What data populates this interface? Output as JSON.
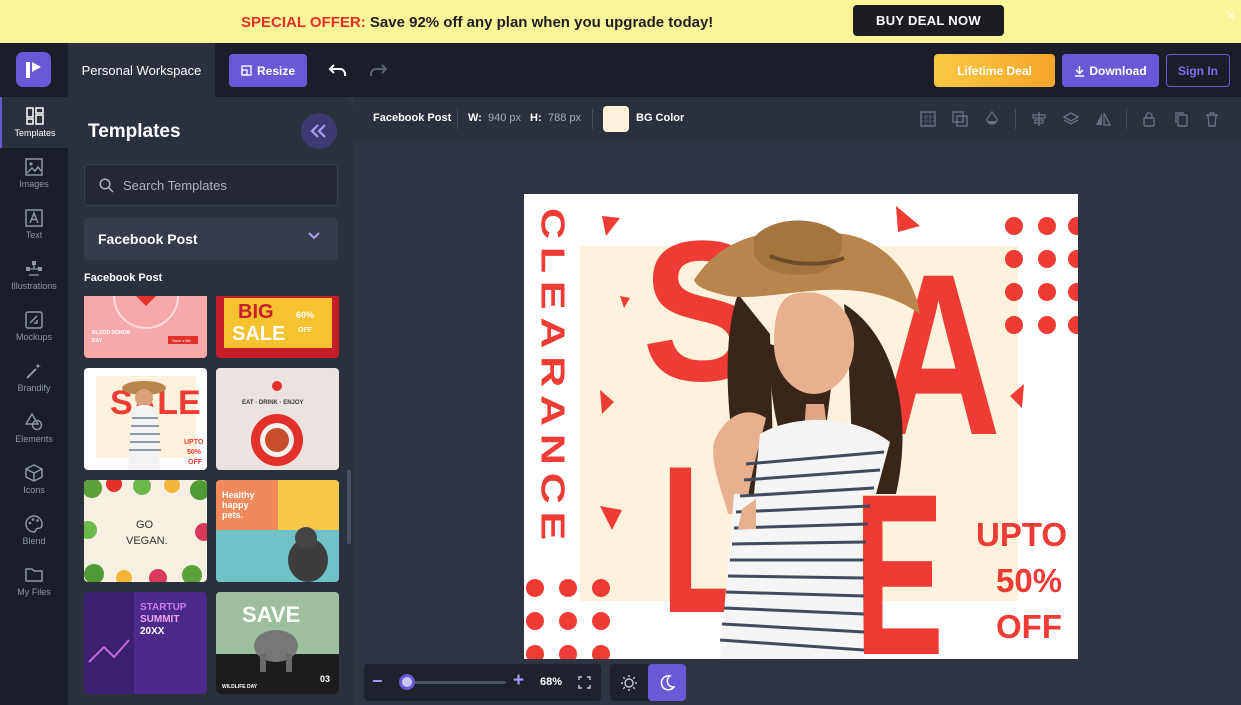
{
  "promo": {
    "highlight": "SPECIAL OFFER:",
    "message": " Save 92% off any plan when you upgrade today!",
    "cta": "BUY DEAL NOW",
    "close": "×"
  },
  "topbar": {
    "workspace": "Personal Workspace",
    "resize": "Resize",
    "lifetime_deal": "Lifetime Deal",
    "download": "Download",
    "sign_in": "Sign In"
  },
  "sidebar": {
    "items": [
      {
        "label": "Templates",
        "icon": "templates-icon"
      },
      {
        "label": "Images",
        "icon": "image-icon"
      },
      {
        "label": "Text",
        "icon": "text-icon"
      },
      {
        "label": "Illustrations",
        "icon": "illustration-icon"
      },
      {
        "label": "Mockups",
        "icon": "mockup-icon"
      },
      {
        "label": "Brandify",
        "icon": "magic-wand-icon"
      },
      {
        "label": "Elements",
        "icon": "shapes-icon"
      },
      {
        "label": "Icons",
        "icon": "cube-icon"
      },
      {
        "label": "Blend",
        "icon": "palette-icon"
      },
      {
        "label": "My Files",
        "icon": "folder-icon"
      }
    ]
  },
  "panel": {
    "title": "Templates",
    "search_placeholder": "Search Templates",
    "category": "Facebook Post",
    "section": "Facebook Post",
    "thumbs": [
      {
        "id": "blood-donor",
        "text": [
          "BLOOD DONOR",
          "DAY",
          "Save a life"
        ]
      },
      {
        "id": "big-sale",
        "text": [
          "BIG",
          "SALE",
          "60%",
          "OFF"
        ]
      },
      {
        "id": "clearance-sale",
        "text": [
          "SALE",
          "UPTO",
          "50%",
          "OFF"
        ]
      },
      {
        "id": "coffee",
        "text": [
          "EAT · DRINK · ENJOY"
        ]
      },
      {
        "id": "go-vegan",
        "text": [
          "GO",
          "VEGAN."
        ]
      },
      {
        "id": "healthy-pets",
        "text": [
          "Healthy",
          "happy",
          "pets."
        ]
      },
      {
        "id": "startup-summit",
        "text": [
          "STARTUP",
          "SUMMIT",
          "20XX"
        ]
      },
      {
        "id": "save-elephant",
        "text": [
          "SAVE",
          "WILDLIFE DAY",
          "03"
        ]
      }
    ]
  },
  "toolbar": {
    "size_name": "Facebook Post",
    "w_label": "W:",
    "w_value": "940 px",
    "h_label": "H:",
    "h_value": "788 px",
    "bg_label": "BG Color",
    "bg_color": "#fff2dc"
  },
  "design": {
    "vertical_text": "CLEARANCE",
    "big_letters": [
      "S",
      "A",
      "L",
      "E"
    ],
    "offer": [
      "UPTO",
      "50%",
      "OFF"
    ],
    "accent": "#ef3b36",
    "cream": "#fff2dc"
  },
  "zoom": {
    "minus": "−",
    "plus": "+",
    "value": "68%",
    "fraction": 0.05
  },
  "colors": {
    "brand": "#6a59d6",
    "promo_bg": "#fbf59a",
    "offer_red": "#e4302b"
  }
}
